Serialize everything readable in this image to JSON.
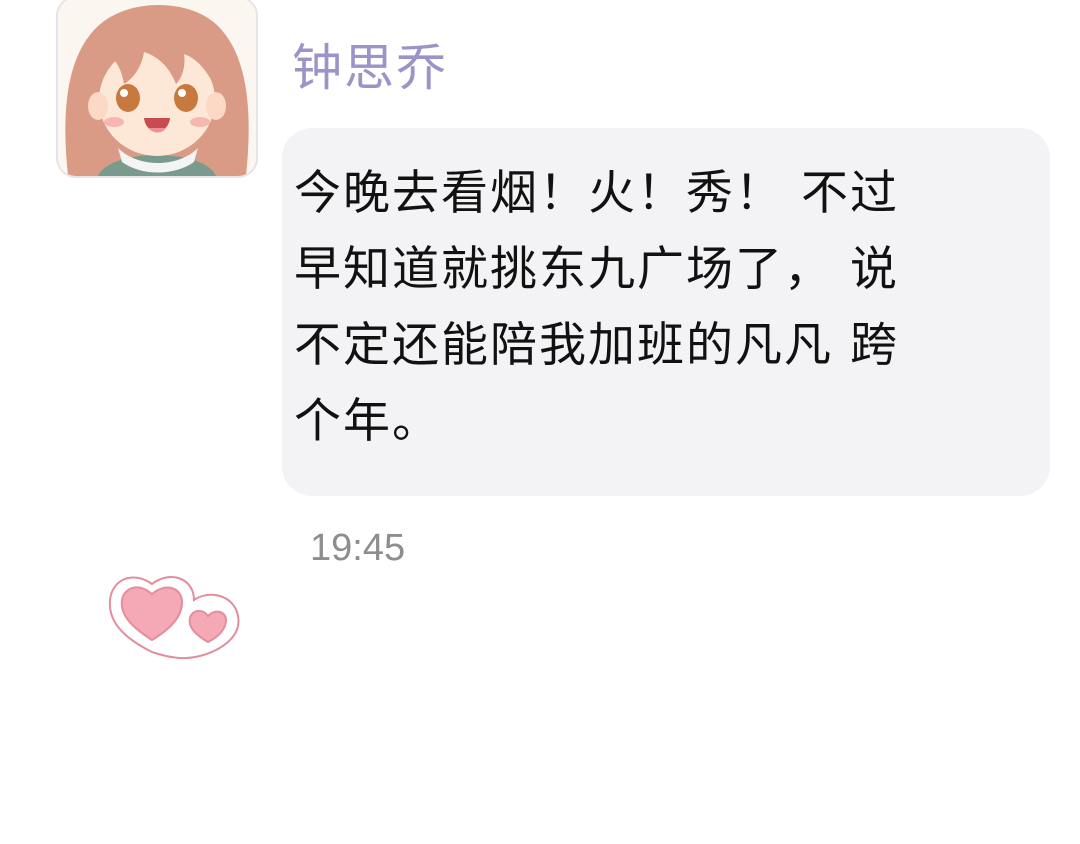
{
  "message": {
    "sender_name": "钟思乔",
    "lines": [
      "今晚去看烟！火！秀！ 不过",
      "早知道就挑东九广场了， 说",
      "不定还能陪我加班的凡凡 跨",
      "个年。"
    ],
    "timestamp": "19:45"
  },
  "avatar": {
    "icon": "girl-avatar",
    "hair_color": "#d99a86",
    "skin_color": "#fde8d8"
  },
  "decoration": {
    "icon": "hearts-sticker",
    "heart_color": "#f5a9b6",
    "outline_color": "#e48d9c"
  }
}
